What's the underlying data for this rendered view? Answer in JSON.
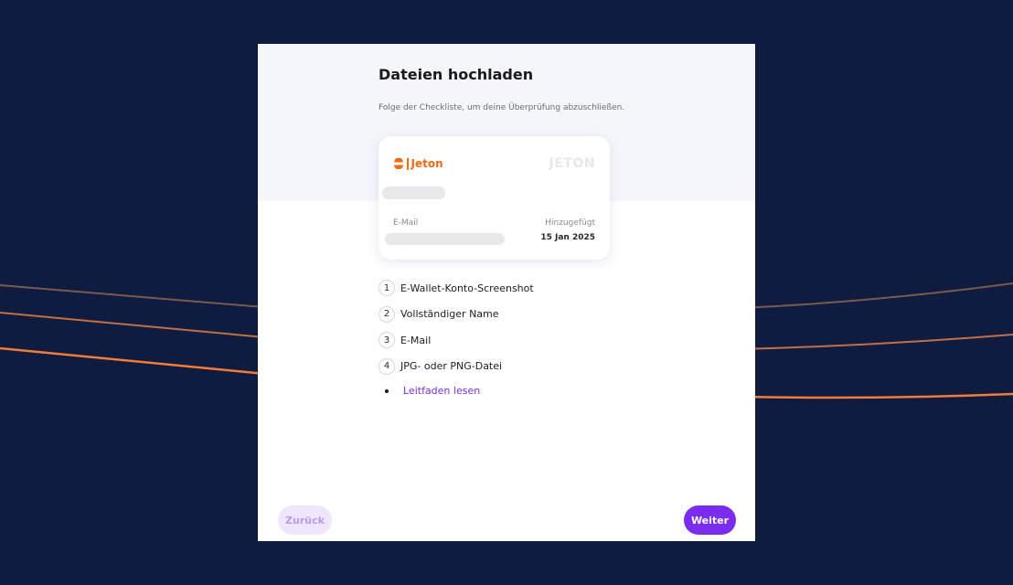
{
  "page": {
    "title": "Dateien hochladen",
    "subtitle": "Folge der Checkliste, um deine Überprüfung abzuschließen."
  },
  "card": {
    "brand": "Jeton",
    "watermark": "JETON",
    "email_label": "E-Mail",
    "added_label": "Hinzugefügt",
    "added_date": "15 Jan 2025"
  },
  "checklist": [
    {
      "number": "1",
      "text": "E-Wallet-Konto-Screenshot"
    },
    {
      "number": "2",
      "text": "Vollständiger Name"
    },
    {
      "number": "3",
      "text": "E-Mail"
    },
    {
      "number": "4",
      "text": "JPG- oder PNG-Datei"
    }
  ],
  "guide_link": "Leitfaden lesen",
  "buttons": {
    "back": "Zurück",
    "next": "Weiter"
  },
  "colors": {
    "background": "#0f1c3f",
    "accent": "#7b2cf0",
    "brand_orange": "#f26a12",
    "card_top": "#f5f6fb"
  },
  "icons": {
    "brand_logo": "jeton-logo-icon",
    "bullet": "bullet-dot-icon"
  }
}
